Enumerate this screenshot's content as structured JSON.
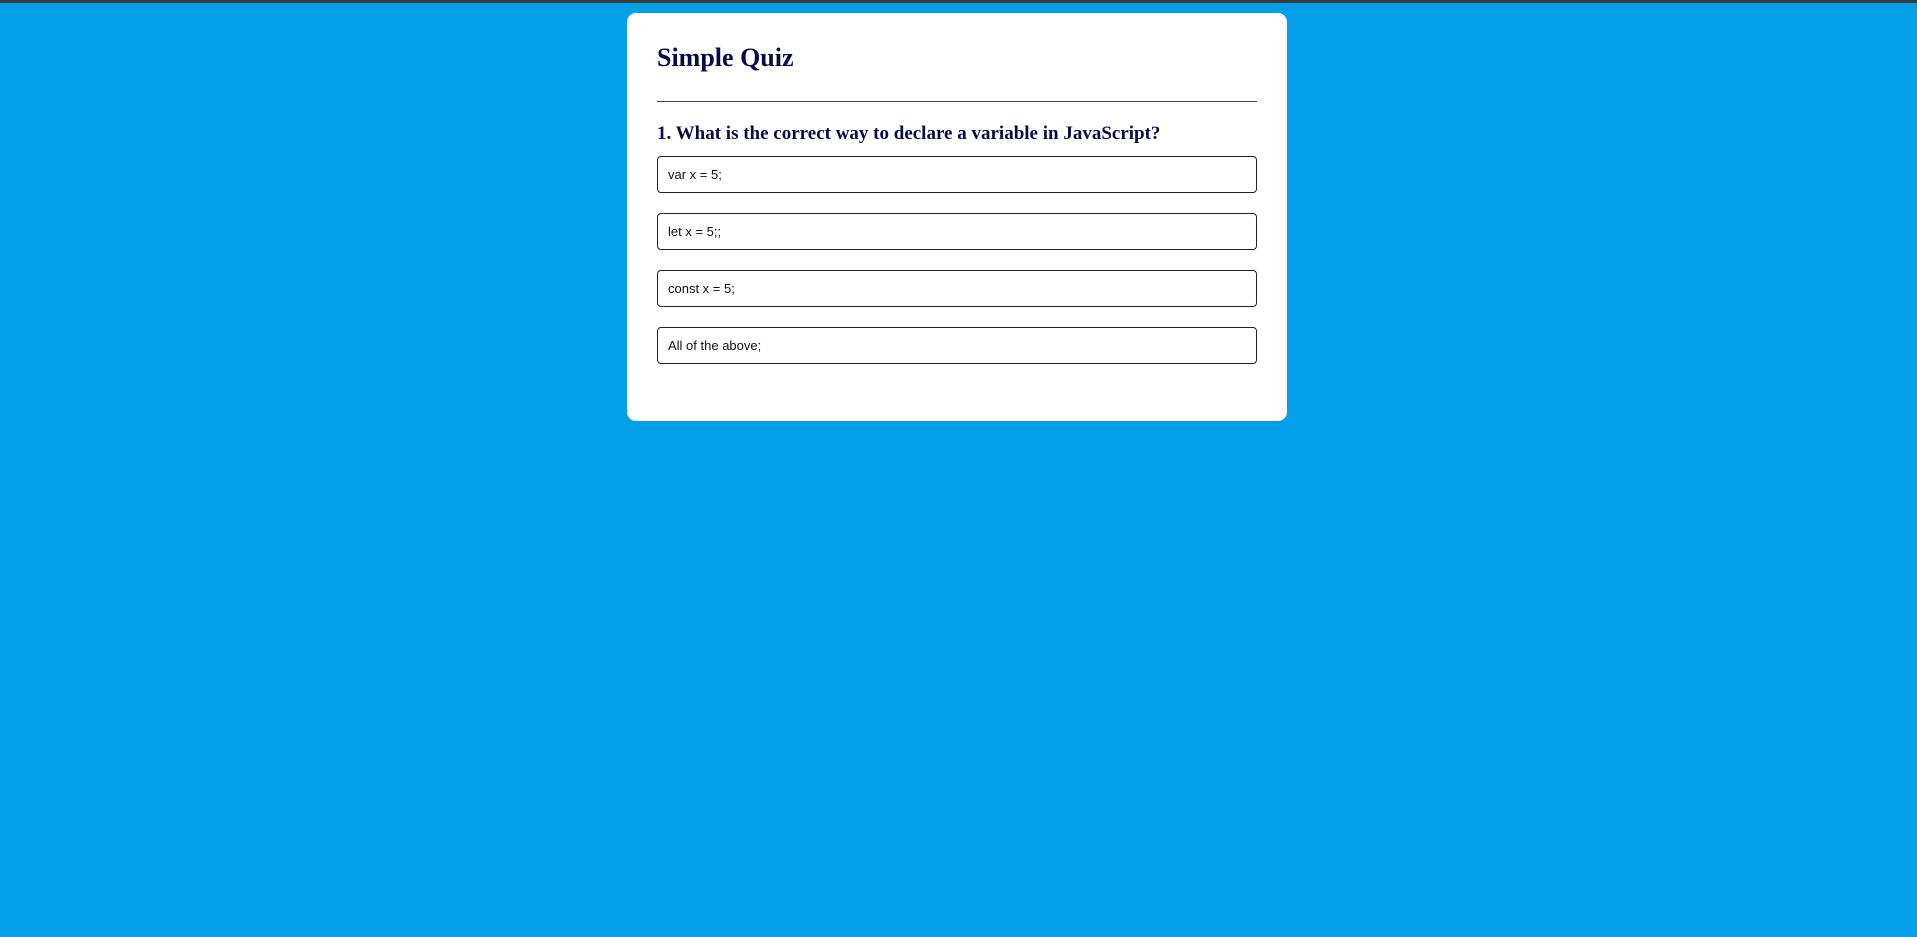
{
  "quiz": {
    "title": "Simple Quiz",
    "question": "1. What is the correct way to declare a variable in JavaScript?",
    "options": [
      "var x = 5;",
      "let x = 5;;",
      "const x = 5;",
      "All of the above;"
    ]
  },
  "colors": {
    "page_background": "#039fe9",
    "card_background": "#ffffff",
    "heading_text": "#0a0a4a",
    "top_bar": "#3a3a3a"
  }
}
